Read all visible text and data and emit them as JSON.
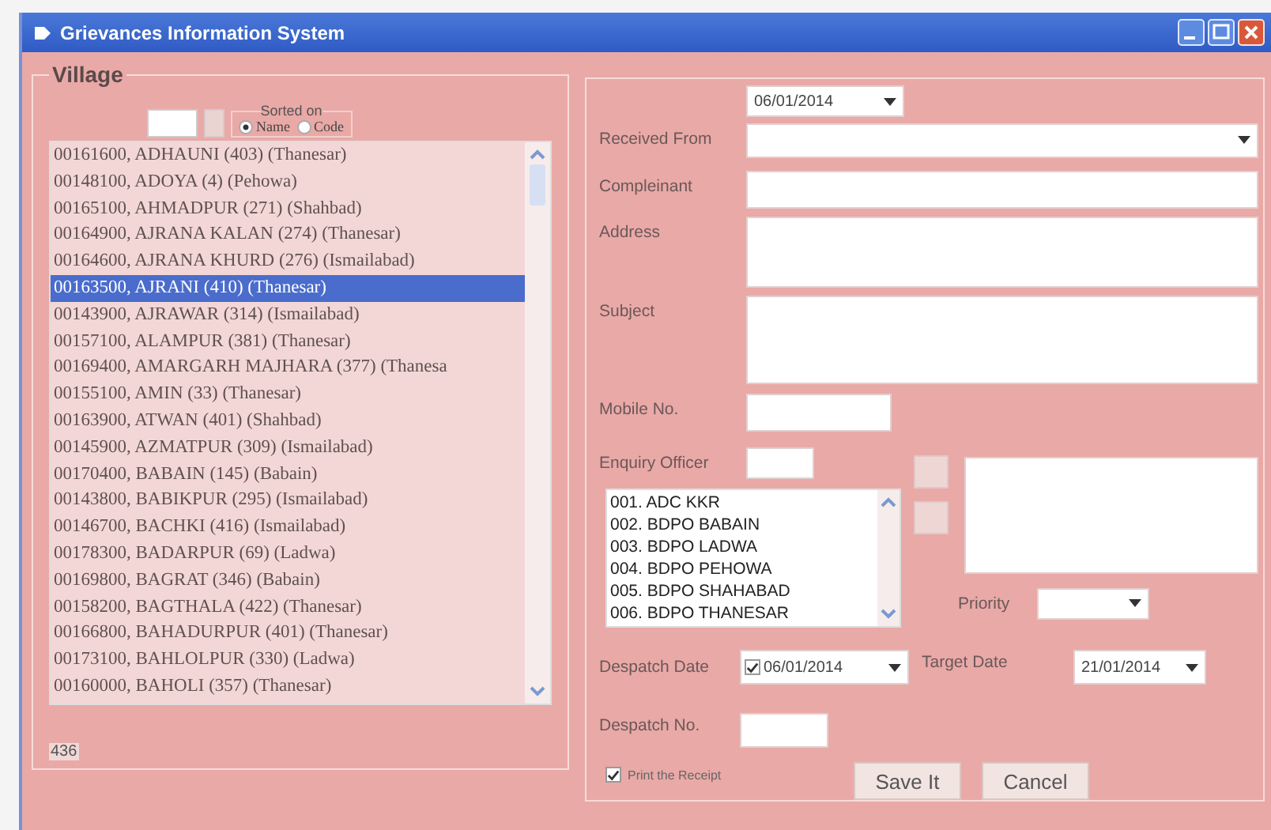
{
  "window": {
    "title": "Grievances Information System"
  },
  "village": {
    "title": "Village",
    "sort": {
      "label": "Sorted on",
      "options": [
        {
          "label": "Name",
          "selected": true
        },
        {
          "label": "Code",
          "selected": false
        }
      ]
    },
    "rows": [
      {
        "text": "00161600, ADHAUNI (403) (Thanesar)",
        "selected": false
      },
      {
        "text": "00148100, ADOYA (4) (Pehowa)",
        "selected": false
      },
      {
        "text": "00165100, AHMADPUR (271) (Shahbad)",
        "selected": false
      },
      {
        "text": "00164900, AJRANA KALAN (274) (Thanesar)",
        "selected": false
      },
      {
        "text": "00164600, AJRANA KHURD (276) (Ismailabad)",
        "selected": false
      },
      {
        "text": "00163500, AJRANI (410) (Thanesar)",
        "selected": true
      },
      {
        "text": "00143900, AJRAWAR (314) (Ismailabad)",
        "selected": false
      },
      {
        "text": "00157100, ALAMPUR (381) (Thanesar)",
        "selected": false
      },
      {
        "text": "00169400, AMARGARH MAJHARA (377) (Thanesa",
        "selected": false
      },
      {
        "text": "00155100, AMIN (33) (Thanesar)",
        "selected": false
      },
      {
        "text": "00163900, ATWAN (401) (Shahbad)",
        "selected": false
      },
      {
        "text": "00145900, AZMATPUR (309) (Ismailabad)",
        "selected": false
      },
      {
        "text": "00170400, BABAIN (145) (Babain)",
        "selected": false
      },
      {
        "text": "00143800, BABIKPUR (295) (Ismailabad)",
        "selected": false
      },
      {
        "text": "00146700, BACHKI (416) (Ismailabad)",
        "selected": false
      },
      {
        "text": "00178300, BADARPUR (69) (Ladwa)",
        "selected": false
      },
      {
        "text": "00169800, BAGRAT (346) (Babain)",
        "selected": false
      },
      {
        "text": "00158200, BAGTHALA (422) (Thanesar)",
        "selected": false
      },
      {
        "text": "00166800, BAHADURPUR (401) (Thanesar)",
        "selected": false
      },
      {
        "text": "00173100, BAHLOLPUR (330) (Ladwa)",
        "selected": false
      },
      {
        "text": "00160000, BAHOLI (357) (Thanesar)",
        "selected": false
      }
    ],
    "count": "436"
  },
  "form": {
    "date": "06/01/2014",
    "fields": [
      {
        "label": "Received From",
        "kind": "combo"
      },
      {
        "label": "Compleinant",
        "kind": "text"
      },
      {
        "label": "Address",
        "kind": "memo"
      },
      {
        "label": "Subject",
        "kind": "memo"
      },
      {
        "label": "Mobile No.",
        "kind": "short"
      }
    ],
    "enquiry": {
      "label": "Enquiry Officer",
      "officers": [
        "001. ADC KKR",
        "002. BDPO BABAIN",
        "003. BDPO LADWA",
        "004. BDPO PEHOWA",
        "005. BDPO SHAHABAD",
        "006. BDPO THANESAR"
      ]
    },
    "priority": {
      "label": "Priority"
    },
    "despatch_date": {
      "label": "Despatch Date",
      "checked": true,
      "value": "06/01/2014"
    },
    "target_date": {
      "label": "Target Date",
      "value": "21/01/2014"
    },
    "despatch_no": {
      "label": "Despatch No."
    },
    "print_receipt": {
      "label": "Print the Receipt",
      "checked": true
    },
    "buttons": [
      {
        "label": "Save It"
      },
      {
        "label": "Cancel"
      }
    ]
  }
}
